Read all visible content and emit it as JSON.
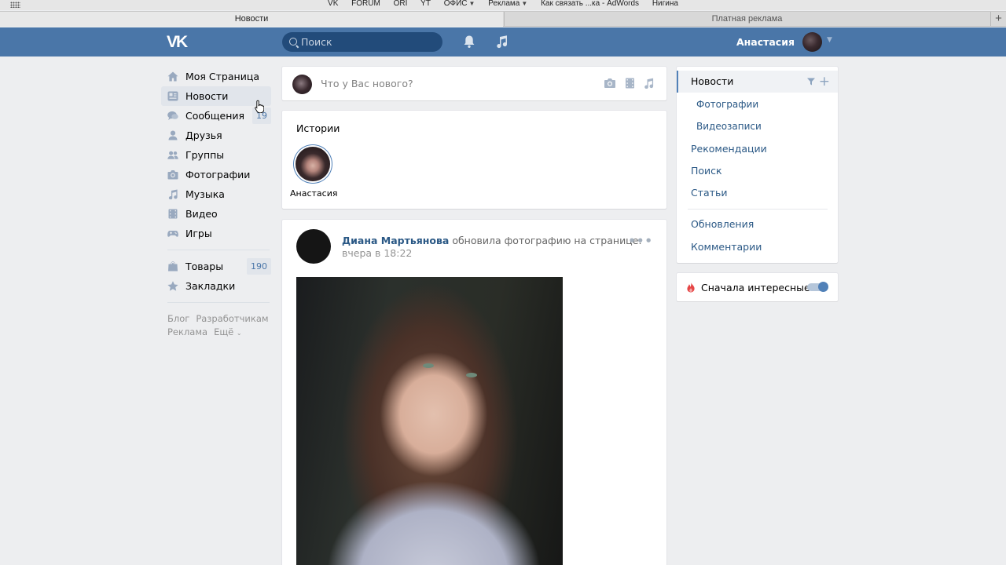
{
  "bookmarks": {
    "items": [
      "VK",
      "FORUM",
      "ORI",
      "YT",
      "ОФИС",
      "Реклама",
      "Как связать ...ка - AdWords",
      "Нигина"
    ]
  },
  "browser_tabs": [
    {
      "label": "Новости",
      "active": true
    },
    {
      "label": "Платная реклама",
      "active": false
    }
  ],
  "header": {
    "logo_text": "VK",
    "search_placeholder": "Поиск",
    "user_name": "Анастасия",
    "accent_color": "#4a76a8"
  },
  "left_menu": {
    "items": [
      {
        "label": "Моя Страница",
        "icon": "home-icon"
      },
      {
        "label": "Новости",
        "icon": "news-icon",
        "active": true
      },
      {
        "label": "Сообщения",
        "icon": "messages-icon",
        "badge": "19"
      },
      {
        "label": "Друзья",
        "icon": "friend-icon"
      },
      {
        "label": "Группы",
        "icon": "groups-icon"
      },
      {
        "label": "Фотографии",
        "icon": "camera-icon"
      },
      {
        "label": "Музыка",
        "icon": "music-icon"
      },
      {
        "label": "Видео",
        "icon": "video-icon"
      },
      {
        "label": "Игры",
        "icon": "gamepad-icon"
      }
    ],
    "items2": [
      {
        "label": "Товары",
        "icon": "bag-icon",
        "badge": "190"
      },
      {
        "label": "Закладки",
        "icon": "star-icon"
      }
    ],
    "footer": [
      "Блог",
      "Разработчикам",
      "Реклама",
      "Ещё"
    ]
  },
  "post_box": {
    "placeholder": "Что у Вас нового?"
  },
  "stories": {
    "title": "Истории",
    "items": [
      {
        "name": "Анастасия"
      }
    ]
  },
  "post": {
    "author": "Диана Мартьянова",
    "action": "обновила фотографию на странице:",
    "time": "вчера в 18:22",
    "more": "•••"
  },
  "right_menu": {
    "items": [
      {
        "label": "Новости",
        "active": true
      },
      {
        "label": "Фотографии",
        "sub": true
      },
      {
        "label": "Видеозаписи",
        "sub": true
      },
      {
        "label": "Рекомендации"
      },
      {
        "label": "Поиск"
      },
      {
        "label": "Статьи"
      },
      {
        "label": "Обновления"
      },
      {
        "label": "Комментарии"
      }
    ]
  },
  "interesting": {
    "label": "Сначала интересные",
    "enabled": true
  }
}
